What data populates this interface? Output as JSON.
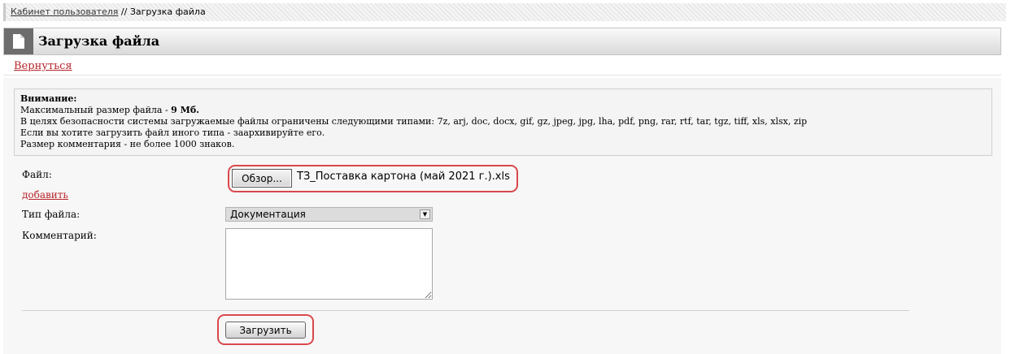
{
  "breadcrumb": {
    "parent_link": "Кабинет пользователя",
    "separator": " // ",
    "current": "Загрузка файла"
  },
  "header": {
    "title": "Загрузка файла",
    "icon": "document-icon"
  },
  "nav": {
    "back_link": "Вернуться"
  },
  "notice": {
    "title": "Внимание:",
    "max_size_prefix": "Максимальный размер файла - ",
    "max_size_value": "9 Мб.",
    "allowed_types": "В целях безопасности системы загружаемые файлы ограничены следующими типами: 7z, arj, doc, docx, gif, gz, jpeg, jpg, lha, pdf, png, rar, rtf, tar, tgz, tiff, xls, xlsx, zip",
    "archive_hint": "Если вы хотите загрузить файл иного типа - заархивируйте его.",
    "comment_limit": "Размер комментария - не более 1000 знаков."
  },
  "form": {
    "file_label": "Файл:",
    "browse_button": "Обзор...",
    "file_name": "ТЗ_Поставка картона (май 2021 г.).xls",
    "add_link": "добавить",
    "type_label": "Тип файла:",
    "type_selected": "Документация",
    "comment_label": "Комментарий:",
    "comment_value": "",
    "submit_button": "Загрузить"
  },
  "colors": {
    "link": "#b8252b",
    "highlight": "#d9484c",
    "header_icon_bg": "#6d6d6d"
  }
}
